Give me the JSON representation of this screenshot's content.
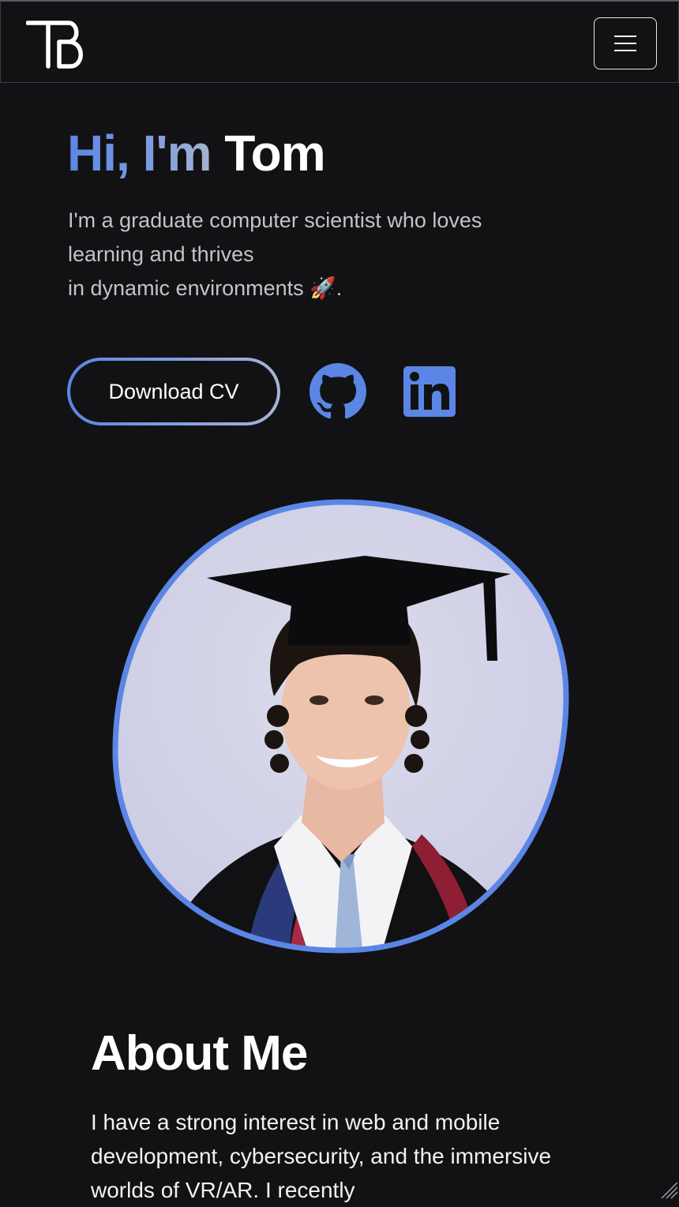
{
  "nav": {
    "logo_alt": "TB",
    "menu_icon": "hamburger-menu-icon"
  },
  "hero": {
    "greeting_highlight": "Hi, I'm",
    "greeting_name": "Tom",
    "subtitle_lines": [
      "I'm a graduate computer scientist who loves",
      "learning and thrives",
      "in dynamic environments 🚀."
    ],
    "cv_button_label": "Download CV",
    "social": [
      {
        "icon": "github-icon"
      },
      {
        "icon": "linkedin-icon"
      }
    ]
  },
  "portrait": {
    "subject": "graduate-portrait",
    "border_color": "#5b86e5"
  },
  "about": {
    "title": "About Me",
    "text": "I have a strong interest in web and mobile development, cybersecurity, and the immersive worlds of VR/AR. I recently"
  },
  "colors": {
    "background": "#121214",
    "accent": "#5b86e5",
    "accent_light": "#a6b2cf",
    "text": "#ffffff",
    "muted_text": "#c3c3c8"
  }
}
